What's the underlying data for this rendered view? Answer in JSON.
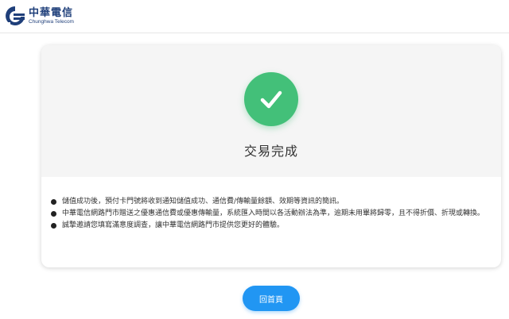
{
  "brand": {
    "name_zh": "中華電信",
    "name_en": "Chunghwa Telecom",
    "logo_icon": "chunghwa-logo-icon",
    "color": "#1f3f7a"
  },
  "result": {
    "icon": "check-icon",
    "icon_color": "#43c079",
    "title": "交易完成"
  },
  "notes": [
    "儲值成功後，預付卡門號將收到通知儲值成功、通信費/傳輸量餘額、效期等資訊的簡訊。",
    "中華電信網路門市贈送之優惠通信費或優惠傳輸量，系統匯入時間以各活動辦法為準，逾期未用畢將歸零，且不得折價、折現或轉換。",
    "誠摯邀請您填寫滿意度調查，讓中華電信網路門市提供您更好的體驗。"
  ],
  "actions": {
    "home_label": "回首頁",
    "home_color": "#2196f3"
  }
}
